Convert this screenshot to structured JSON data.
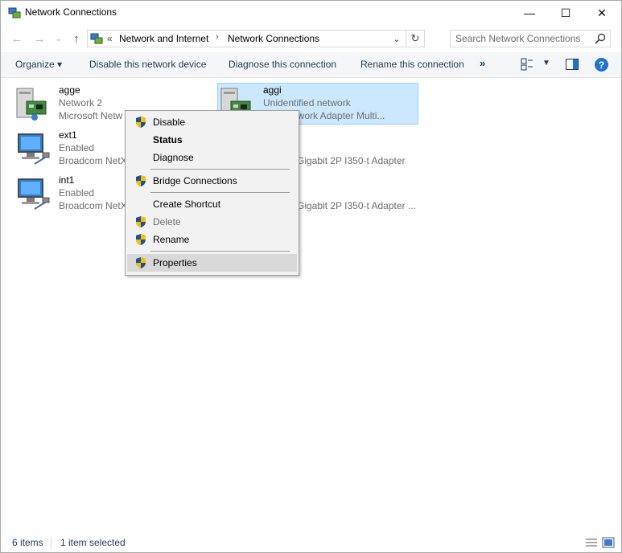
{
  "window": {
    "title": "Network Connections",
    "minimize_glyph": "—",
    "maximize_glyph": "☐",
    "close_glyph": "✕"
  },
  "address_bar": {
    "overflow": "«",
    "segments": [
      "Network and Internet",
      "Network Connections"
    ],
    "separator": "›"
  },
  "search": {
    "placeholder": "Search Network Connections"
  },
  "toolbar": {
    "organize": "Organize ▾",
    "disable": "Disable this network device",
    "diagnose": "Diagnose this connection",
    "rename": "Rename this connection",
    "more": "»",
    "help": "?"
  },
  "connections": [
    {
      "name": "agge",
      "status": "Network  2",
      "adapter": "Microsoft Netw",
      "selected": false,
      "icon": "wired-network-adapter-icon"
    },
    {
      "name": "aggi",
      "status": "Unidentified network",
      "adapter": "ft Network Adapter Multi...",
      "selected": true,
      "icon": "wired-network-adapter-icon"
    },
    {
      "name": "ext1",
      "status": "Enabled",
      "adapter": "Broadcom NetX",
      "selected": false,
      "icon": "ethernet-icon"
    },
    {
      "name": "",
      "status": "",
      "adapter": "Gigabit 2P I350-t Adapter",
      "selected": false,
      "icon": ""
    },
    {
      "name": "int1",
      "status": "Enabled",
      "adapter": "Broadcom NetX",
      "selected": false,
      "icon": "ethernet-icon"
    },
    {
      "name": "",
      "status": "",
      "adapter": "Gigabit 2P I350-t Adapter ...",
      "selected": false,
      "icon": ""
    }
  ],
  "context_menu": {
    "items": [
      {
        "label": "Disable",
        "shield": true,
        "bold": false,
        "disabled": false
      },
      {
        "label": "Status",
        "shield": false,
        "bold": true,
        "disabled": false
      },
      {
        "label": "Diagnose",
        "shield": false,
        "bold": false,
        "disabled": false
      },
      {
        "label": "Bridge Connections",
        "shield": true,
        "bold": false,
        "disabled": false
      },
      {
        "label": "Create Shortcut",
        "shield": false,
        "bold": false,
        "disabled": false
      },
      {
        "label": "Delete",
        "shield": true,
        "bold": false,
        "disabled": true
      },
      {
        "label": "Rename",
        "shield": true,
        "bold": false,
        "disabled": false
      },
      {
        "label": "Properties",
        "shield": true,
        "bold": false,
        "disabled": false,
        "highlighted": true
      }
    ]
  },
  "status_bar": {
    "item_count": "6 items",
    "selection": "1 item selected"
  },
  "colors": {
    "selection_bg": "#cce8ff",
    "selection_border": "#99d1ff",
    "link_text": "#1e395b",
    "help_blue": "#1e73d2",
    "shield_blue": "#1f4e9c",
    "shield_yellow": "#f2c200"
  }
}
